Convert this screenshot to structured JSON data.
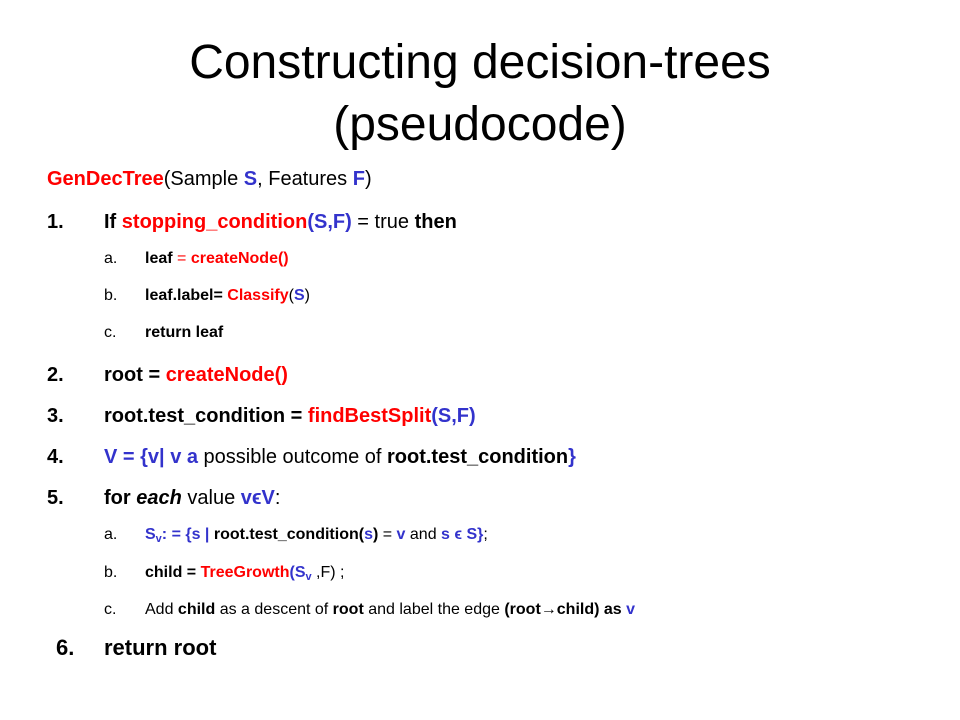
{
  "title": {
    "line1": "Constructing decision-trees",
    "line2": "(pseudocode)"
  },
  "header": {
    "fn": "GenDecTree",
    "open": "(Sample ",
    "s": "S",
    "mid": ", Features ",
    "f": "F",
    "close": ")"
  },
  "step1": {
    "num": "1.",
    "if": "If",
    "cond": "stopping_condition",
    "args": "(S,F)",
    "eq": " = true ",
    "then": "then",
    "a": {
      "num": "a.",
      "t1": "leaf",
      "t2": " = ",
      "t3": "createNode()"
    },
    "b": {
      "num": "b.",
      "t1": "leaf.label=",
      "t2": "Classify",
      "t3": "(",
      "t4": "S",
      "t5": ")"
    },
    "c": {
      "num": "c.",
      "t1": "return leaf"
    }
  },
  "step2": {
    "num": "2.",
    "t1": "root",
    "t2": " = ",
    "t3": "createNode()"
  },
  "step3": {
    "num": "3.",
    "t1": "root.test_condition",
    "t2": " = ",
    "t3": "findBestSplit",
    "t4": "(S,F)"
  },
  "step4": {
    "num": "4.",
    "t1": "V = {v| v a",
    "t2": " possible outcome of ",
    "t3": "root.test_condition",
    "t4": "}"
  },
  "step5": {
    "num": "5.",
    "for": "for",
    "each": " each",
    "value": " value ",
    "vev": "vϵV",
    "colon": ":",
    "a": {
      "num": "a.",
      "sv": "S",
      "sub": "v",
      "t1": ": = {s | ",
      "t2": "root.test_condition(",
      "t3": "s",
      "t4": ")",
      "t5": " = ",
      "t6": "v",
      "t7": " and ",
      "t8": "s ϵ S}",
      "t9": ";"
    },
    "b": {
      "num": "b.",
      "t1": "child = ",
      "t2": "TreeGrowth",
      "t3": "(S",
      "sub": "v",
      "t4": " ,F) ;"
    },
    "c": {
      "num": "c.",
      "t1": "Add ",
      "t2": "child",
      "t3": " as a descent of ",
      "t4": "root",
      "t5": " and label the edge ",
      "t6": "(root",
      "arrow": "→",
      "t7": "child)",
      "t8": " as ",
      "t9": "v"
    }
  },
  "step6": {
    "num": "6.",
    "t1": "return root"
  }
}
